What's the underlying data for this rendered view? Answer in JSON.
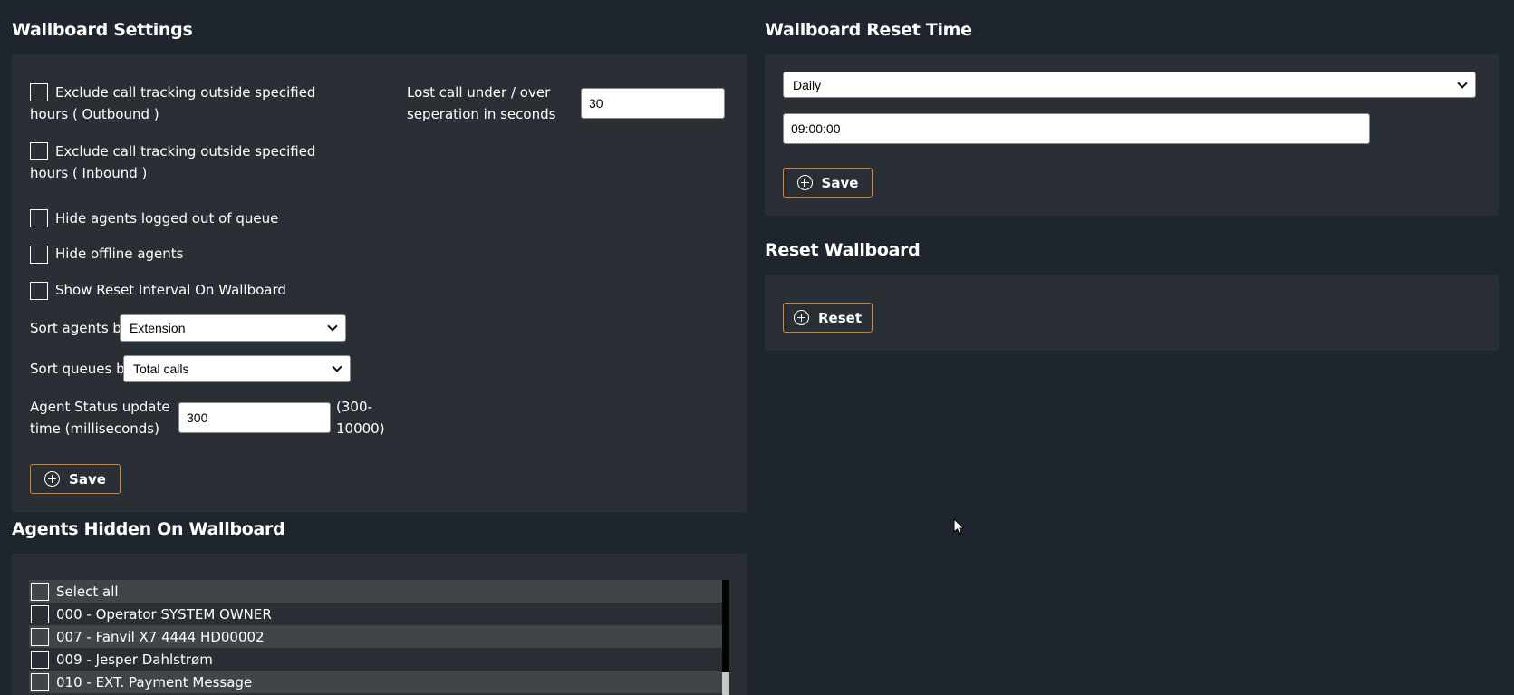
{
  "wallboard_settings": {
    "title": "Wallboard Settings",
    "exclude_outbound_label": "Exclude call tracking outside specified hours ( Outbound )",
    "exclude_inbound_label": "Exclude call tracking outside specified hours ( Inbound )",
    "hide_logged_out_label": "Hide agents logged out of queue",
    "hide_offline_label": "Hide offline agents",
    "show_reset_interval_label": "Show Reset Interval On Wallboard",
    "lost_call_label_line1": "Lost call under / over",
    "lost_call_label_line2": "seperation in seconds",
    "lost_call_value": "30",
    "sort_agents_label": "Sort agents by",
    "sort_agents_value": "Extension",
    "sort_queues_label": "Sort queues by",
    "sort_queues_value": "Total calls",
    "agent_status_label_line1": "Agent Status update",
    "agent_status_label_line2": "time (milliseconds)",
    "agent_status_value": "300",
    "agent_status_range_line1": "(300-",
    "agent_status_range_line2": "10000)",
    "save_label": "Save"
  },
  "reset_time": {
    "title": "Wallboard Reset Time",
    "frequency_value": "Daily",
    "time_value": "09:00:00",
    "save_label": "Save"
  },
  "reset_wallboard": {
    "title": "Reset Wallboard",
    "reset_label": "Reset"
  },
  "agents_hidden": {
    "title": "Agents Hidden On Wallboard",
    "select_all_label": "Select all",
    "agents": [
      "000 - Operator SYSTEM OWNER",
      "007 - Fanvil X7 4444 HD00002",
      "009 - Jesper Dahlstrøm",
      "010 - EXT. Payment Message"
    ]
  },
  "colors": {
    "background": "#1f252c",
    "panel": "#2a2f35",
    "button_border": "#d9822b"
  }
}
